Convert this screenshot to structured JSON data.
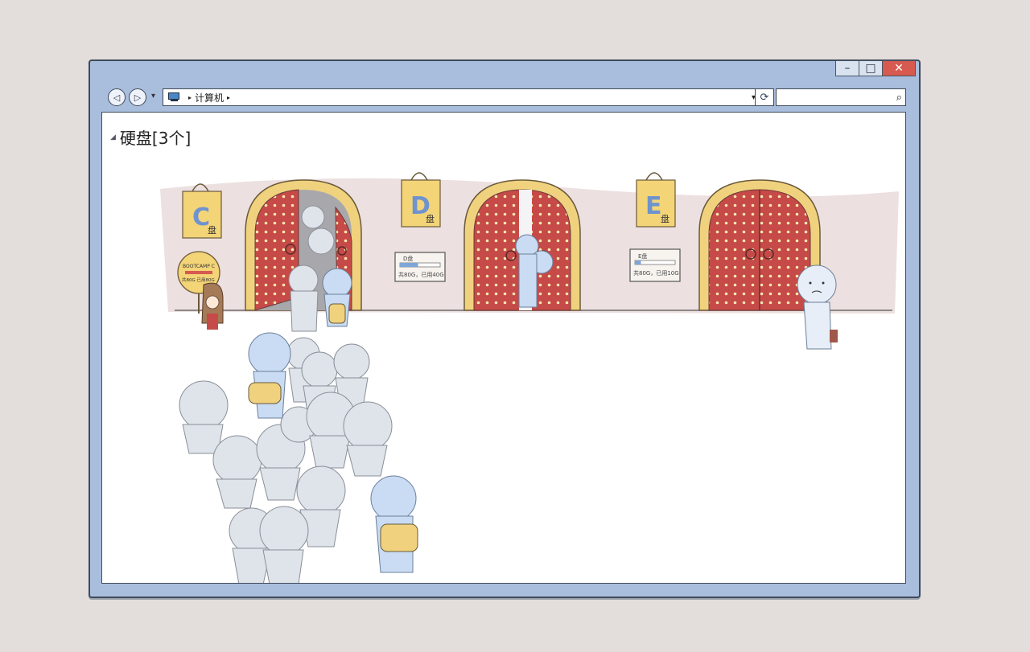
{
  "window": {
    "buttons": {
      "minimize": "–",
      "maximize": "□",
      "close": "✕"
    }
  },
  "nav": {
    "back": "◁",
    "forward": "▷",
    "history": "▾"
  },
  "address": {
    "path_label": "计算机",
    "separator": "▸",
    "dropdown": "▾"
  },
  "refresh_icon": "⟳",
  "search": {
    "placeholder": "",
    "icon": "⌕"
  },
  "group": {
    "title": "硬盘",
    "count": "[3个]"
  },
  "drives": [
    {
      "letter": "C",
      "tag_suffix": "盘",
      "sign_line1": "BOOTCAMP C",
      "sign_line2": "共80G 已用80G"
    },
    {
      "letter": "D",
      "tag_suffix": "盘",
      "plaque_label": "D盘",
      "plaque_usage": "共80G，已用40G",
      "usage_fraction": 0.45
    },
    {
      "letter": "E",
      "tag_suffix": "盘",
      "plaque_label": "E盘",
      "plaque_usage": "共80G，已用10G",
      "usage_fraction": 0.15
    }
  ],
  "colors": {
    "frame": "#a9bedd",
    "door_red": "#c64a48",
    "door_frame": "#f0d27e",
    "tag_yellow": "#f3d477",
    "letter_blue": "#6f93cf",
    "figure": "#dfe3ea",
    "figure_blue": "#c9dcf3"
  }
}
